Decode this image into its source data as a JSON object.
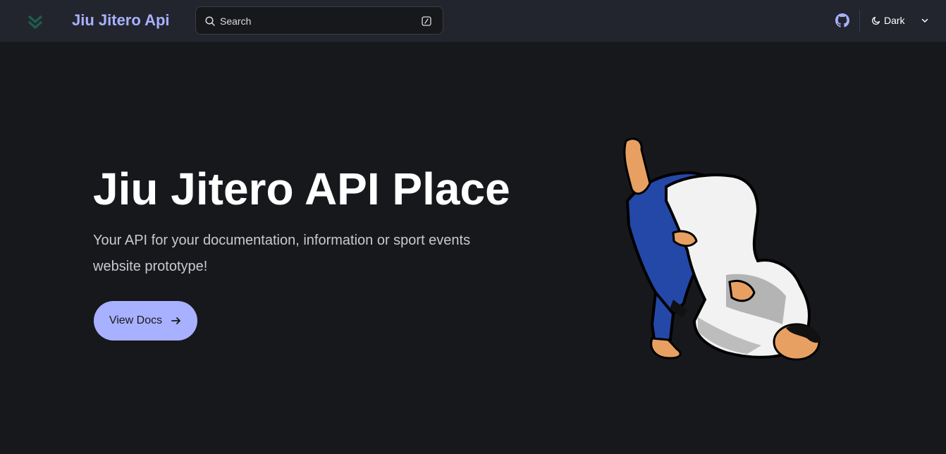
{
  "header": {
    "site_title": "Jiu Jitero Api",
    "logo_icon": "double-chevron-down-icon",
    "search": {
      "placeholder": "Search",
      "icon": "search-icon",
      "shortcut_icon": "slash-key-icon"
    },
    "github_icon": "github-icon",
    "theme": {
      "label": "Dark",
      "icon": "moon-icon",
      "dropdown_icon": "chevron-down-icon"
    }
  },
  "hero": {
    "title": "Jiu Jitero API Place",
    "description": "Your API for your documentation, information or sport events website prototype!",
    "cta_label": "View Docs",
    "cta_icon": "arrow-right-icon",
    "image": "jiu-jitsu-guard-illustration"
  },
  "colors": {
    "background": "#17181c",
    "navbar": "#23252e",
    "accent": "#a8b1ff",
    "logo": "#1f5c4c"
  }
}
